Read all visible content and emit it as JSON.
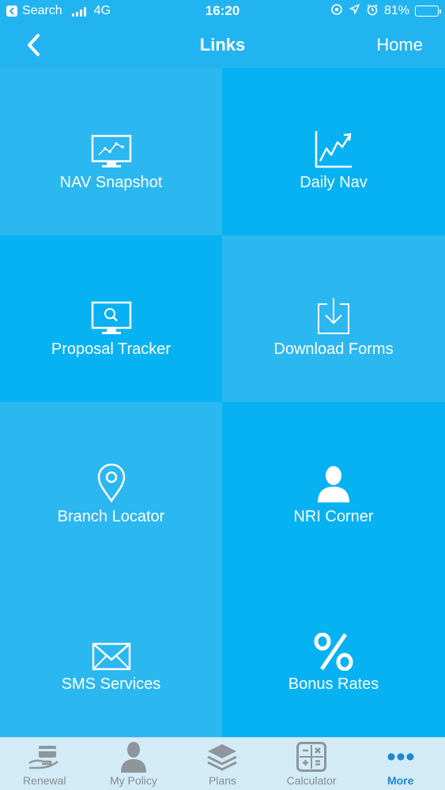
{
  "status": {
    "back_app": "Search",
    "network": "4G",
    "time": "16:20",
    "battery_level": 0.81,
    "battery_text": "81%"
  },
  "nav": {
    "title": "Links",
    "home_label": "Home"
  },
  "tiles": [
    {
      "label": "NAV Snapshot",
      "icon": "monitor-chart-icon"
    },
    {
      "label": "Daily Nav",
      "icon": "line-chart-icon"
    },
    {
      "label": "Proposal Tracker",
      "icon": "monitor-search-icon"
    },
    {
      "label": "Download Forms",
      "icon": "download-icon"
    },
    {
      "label": "Branch Locator",
      "icon": "location-pin-icon"
    },
    {
      "label": "NRI Corner",
      "icon": "person-icon"
    },
    {
      "label": "SMS Services",
      "icon": "envelope-icon"
    },
    {
      "label": "Bonus Rates",
      "icon": "percent-icon"
    }
  ],
  "tabs": [
    {
      "label": "Renewal",
      "icon": "renewal-icon"
    },
    {
      "label": "My Policy",
      "icon": "user-icon"
    },
    {
      "label": "Plans",
      "icon": "layers-icon"
    },
    {
      "label": "Calculator",
      "icon": "calculator-icon"
    },
    {
      "label": "More",
      "icon": "more-dots-icon",
      "active": true
    }
  ],
  "colors": {
    "header": "#22b4f0",
    "tile_light": "#2bb7f0",
    "tile_dark": "#06b2f2",
    "tab_bar": "#d2ebf6",
    "tab_active": "#1f86d0",
    "tab_inactive": "#858c92"
  }
}
